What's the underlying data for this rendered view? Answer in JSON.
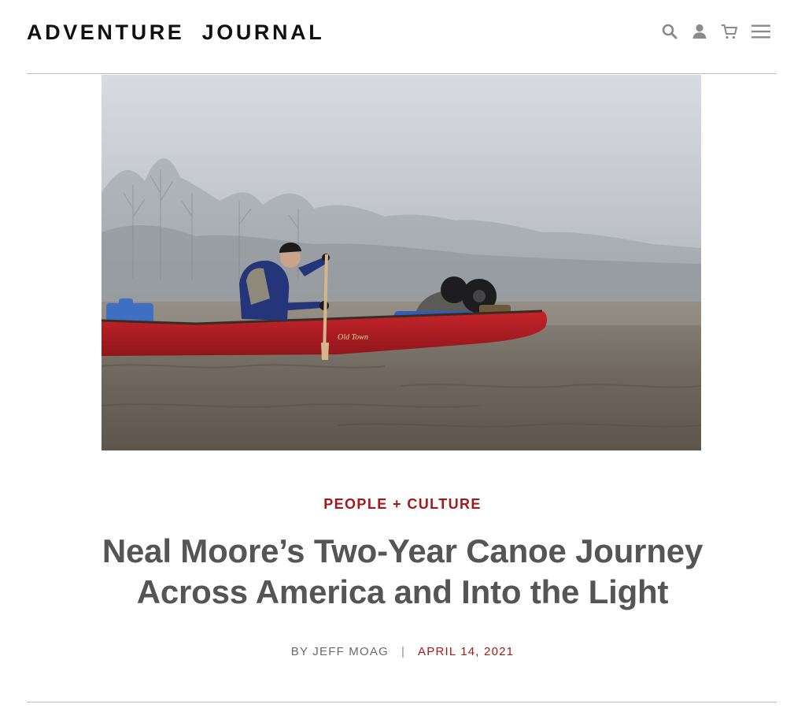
{
  "header": {
    "logo": "ADVENTURE  JOURNAL",
    "icons": [
      "search-icon",
      "account-icon",
      "cart-icon",
      "menu-icon"
    ]
  },
  "hero": {
    "canoe_brand": "Old Town"
  },
  "article": {
    "category": "PEOPLE + CULTURE",
    "title": "Neal Moore’s Two-Year Canoe Journey Across America and Into the Light",
    "byline_author": "BY JEFF MOAG",
    "byline_separator": "|",
    "date": "APRIL 14, 2021"
  },
  "colors": {
    "accent": "#a31919",
    "title": "#555555",
    "rule": "#bdbdbd"
  }
}
